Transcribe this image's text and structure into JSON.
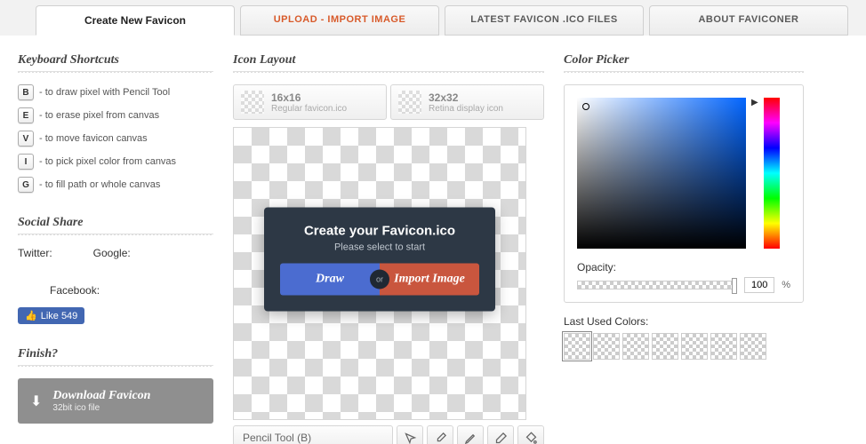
{
  "tabs": {
    "create": "Create New Favicon",
    "upload": "UPLOAD - IMPORT IMAGE",
    "latest": "LATEST FAVICON .ICO FILES",
    "about": "ABOUT FAVICONER"
  },
  "shortcuts": {
    "title": "Keyboard Shortcuts",
    "items": [
      {
        "key": "B",
        "desc": "- to draw pixel with Pencil Tool"
      },
      {
        "key": "E",
        "desc": "- to erase pixel from canvas"
      },
      {
        "key": "V",
        "desc": "- to move favicon canvas"
      },
      {
        "key": "I",
        "desc": "- to pick pixel color from canvas"
      },
      {
        "key": "G",
        "desc": "- to fill path or whole canvas"
      }
    ]
  },
  "social": {
    "title": "Social Share",
    "twitter": "Twitter:",
    "google": "Google:",
    "facebook": "Facebook:",
    "fb_like": "Like 549"
  },
  "finish": {
    "title": "Finish?",
    "btn_title": "Download Favicon",
    "btn_sub": "32bit ico file"
  },
  "layout": {
    "title": "Icon Layout",
    "size1_title": "16x16",
    "size1_sub": "Regular favicon.ico",
    "size2_title": "32x32",
    "size2_sub": "Retina display icon",
    "overlay_title": "Create your Favicon.ico",
    "overlay_sub": "Please select to start",
    "draw": "Draw",
    "or": "or",
    "import": "Import Image",
    "tool_label": "Pencil Tool (B)"
  },
  "picker": {
    "title": "Color Picker",
    "opacity_label": "Opacity:",
    "opacity_val": "100",
    "pct": "%",
    "last_label": "Last Used Colors:"
  }
}
